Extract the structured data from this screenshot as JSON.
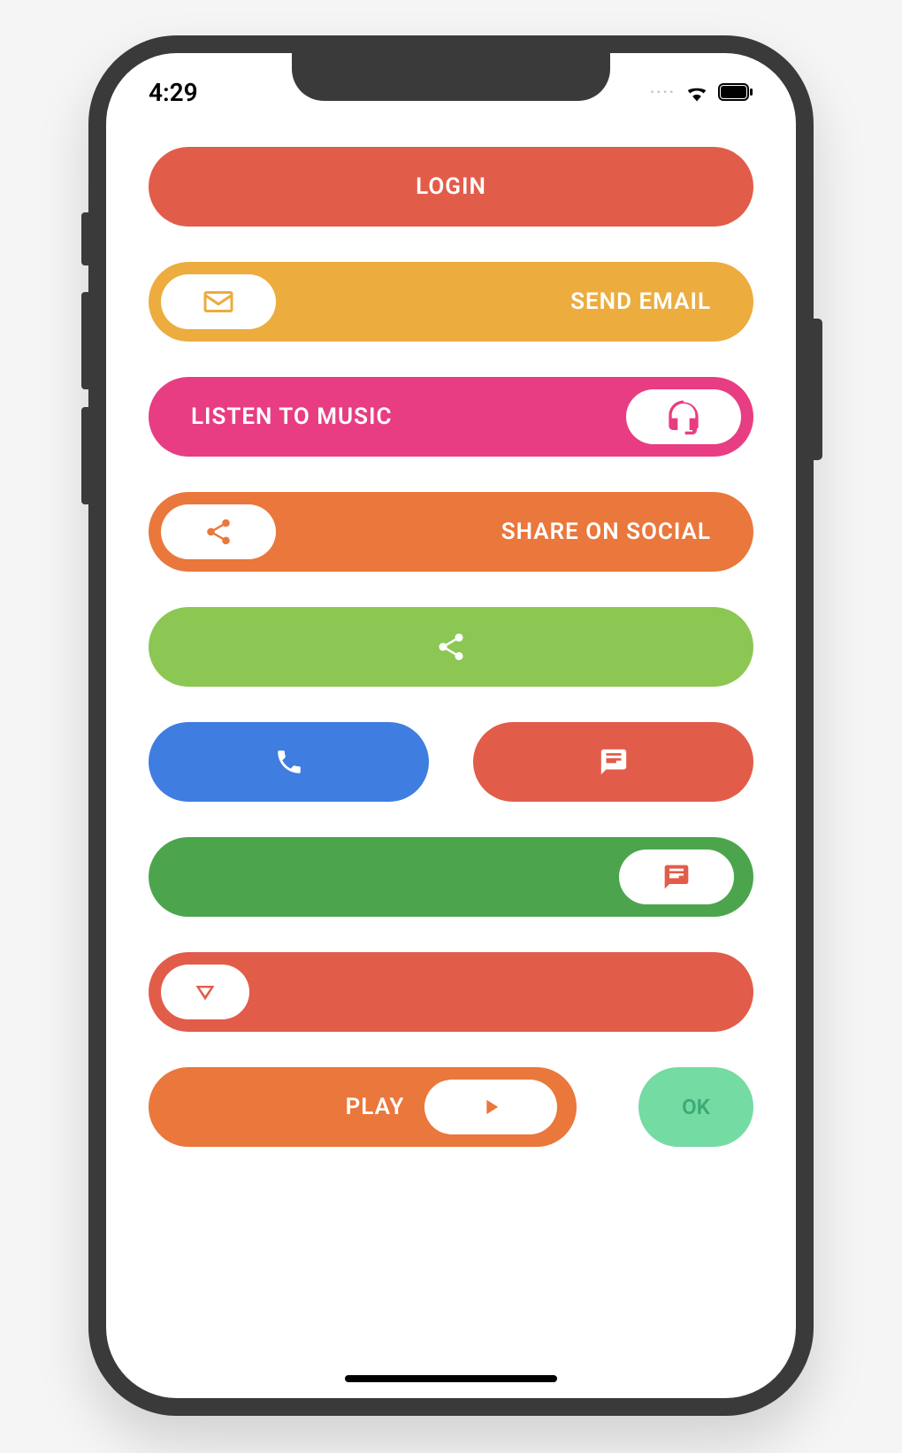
{
  "status": {
    "time": "4:29"
  },
  "colors": {
    "red": "#e25c4a",
    "yellow": "#ecac3e",
    "pink": "#e83d82",
    "orange": "#ea773b",
    "lightGreen": "#8bc752",
    "blue": "#3f7de0",
    "green": "#4ca54c",
    "mint": "#74dba3",
    "mintText": "#3caa77"
  },
  "buttons": {
    "login": {
      "label": "LOGIN"
    },
    "sendEmail": {
      "label": "SEND EMAIL",
      "icon": "mail-icon"
    },
    "listenMusic": {
      "label": "LISTEN TO MUSIC",
      "icon": "headset-icon"
    },
    "shareSocial": {
      "label": "SHARE ON SOCIAL",
      "icon": "share-icon"
    },
    "shareOnly": {
      "icon": "share-icon"
    },
    "call": {
      "icon": "phone-icon"
    },
    "chat": {
      "icon": "chat-icon"
    },
    "chatPill": {
      "icon": "chat-icon"
    },
    "details": {
      "icon": "triangle-down-icon"
    },
    "play": {
      "label": "PLAY",
      "icon": "play-icon"
    },
    "ok": {
      "label": "OK"
    }
  }
}
